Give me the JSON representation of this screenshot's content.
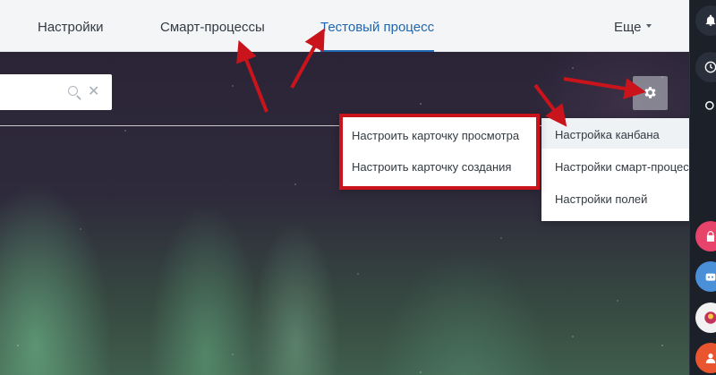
{
  "tabs": {
    "settings": "Настройки",
    "smart_processes": "Смарт-процессы",
    "test_process": "Тестовый процесс",
    "more": "Еще"
  },
  "search": {
    "clear_glyph": "✕"
  },
  "submenu": {
    "view_card": "Настроить карточку просмотра",
    "create_card": "Настроить карточку создания"
  },
  "main_menu": {
    "kanban": "Настройка канбана",
    "smart_process_settings": "Настройки смарт-процесса",
    "field_settings": "Настройки полей",
    "chevron": "›"
  },
  "icons": [
    "gear-icon",
    "search-icon",
    "clear-icon",
    "bell-icon",
    "lock-icon"
  ],
  "colors": {
    "active_tab": "#2067b0",
    "annotation": "#c8141a",
    "rail": "#1b2029"
  }
}
